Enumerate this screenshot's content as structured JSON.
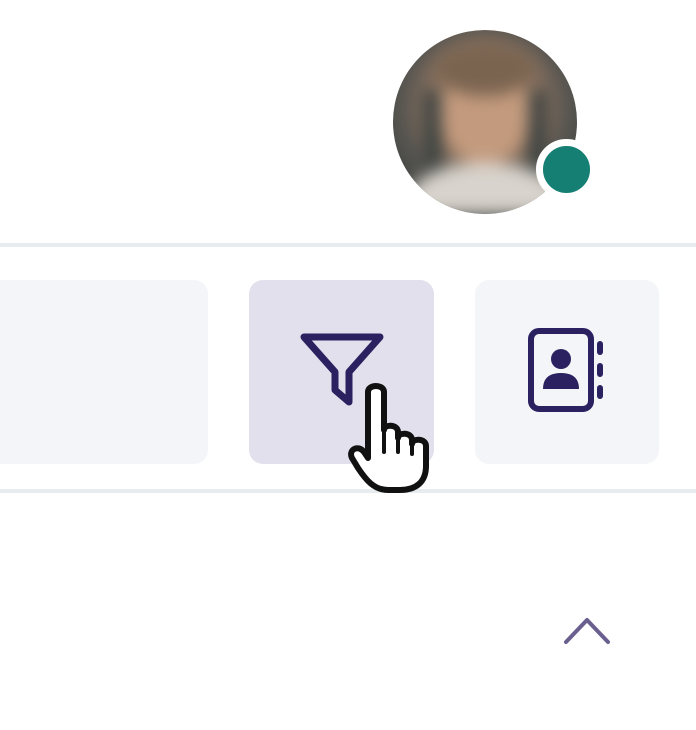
{
  "header": {
    "avatar": {
      "icon": "user-avatar",
      "status_color": "#147f72"
    }
  },
  "toolbar": {
    "search_slot": {
      "icon": "empty"
    },
    "filter_button": {
      "icon": "filter-funnel-icon",
      "state": "hovered",
      "color": "#2b2160"
    },
    "contacts_button": {
      "icon": "contact-book-icon",
      "color": "#2b2160"
    }
  },
  "cursor": {
    "icon": "hand-pointer-cursor"
  },
  "collapse": {
    "icon": "chevron-up-icon",
    "color": "#6a5f8f"
  }
}
